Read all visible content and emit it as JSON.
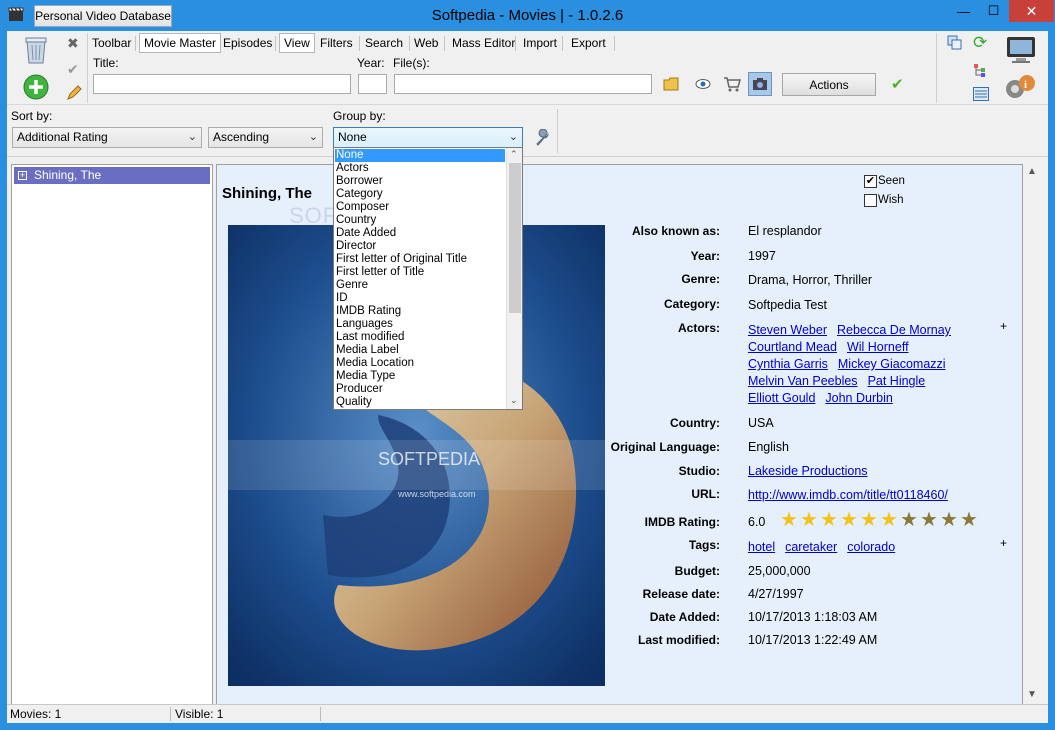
{
  "window": {
    "title": "Softpedia - Movies | - 1.0.2.6",
    "app_button": "Personal Video Database",
    "min": "—",
    "max": "☐",
    "close": "✕"
  },
  "toolbar": {
    "tabs": [
      "Toolbar",
      "Movie Master",
      "Episodes",
      "View",
      "Filters",
      "Search",
      "Web",
      "Mass Editor",
      "Import",
      "Export"
    ],
    "active_tab": "Movie Master",
    "title_label": "Title:",
    "year_label": "Year:",
    "files_label": "File(s):",
    "title_value": "",
    "year_value": "",
    "files_value": "",
    "actions_label": "Actions"
  },
  "sortbar": {
    "sort_by_label": "Sort by:",
    "sort_by_value": "Additional Rating",
    "order_value": "Ascending",
    "group_by_label": "Group by:",
    "group_by_value": "None"
  },
  "group_options": [
    "None",
    "Actors",
    "Borrower",
    "Category",
    "Composer",
    "Country",
    "Date Added",
    "Director",
    "First letter of Original Title",
    "First letter of Title",
    "Genre",
    "ID",
    "IMDB Rating",
    "Languages",
    "Last modified",
    "Media Label",
    "Media Location",
    "Media Type",
    "Producer",
    "Quality"
  ],
  "tree": {
    "expander": "+",
    "item": "Shining, The"
  },
  "movie": {
    "title": "Shining, The",
    "seen_label": "Seen",
    "seen_checked": true,
    "wish_label": "Wish",
    "wish_checked": false,
    "fields": {
      "aka_label": "Also known as:",
      "aka": "El resplandor",
      "year_label": "Year:",
      "year": "1997",
      "genre_label": "Genre:",
      "genre": "Drama, Horror, Thriller",
      "category_label": "Category:",
      "category": "Softpedia Test",
      "actors_label": "Actors:",
      "actors": [
        "Steven Weber",
        "Rebecca De Mornay",
        "Courtland Mead",
        "Wil Horneff",
        "Cynthia Garris",
        "Mickey Giacomazzi",
        "Melvin Van Peebles",
        "Pat Hingle",
        "Elliott Gould",
        "John Durbin"
      ],
      "country_label": "Country:",
      "country": "USA",
      "language_label": "Original Language:",
      "language": "English",
      "studio_label": "Studio:",
      "studio": "Lakeside Productions",
      "url_label": "URL:",
      "url": "http://www.imdb.com/title/tt0118460/",
      "rating_label": "IMDB Rating:",
      "rating": "6.0",
      "rating_stars": 6,
      "rating_max": 10,
      "tags_label": "Tags:",
      "tags": [
        "hotel",
        "caretaker",
        "colorado"
      ],
      "budget_label": "Budget:",
      "budget": "25,000,000",
      "release_label": "Release date:",
      "release": "4/27/1997",
      "added_label": "Date Added:",
      "added": "10/17/2013 1:18:03 AM",
      "modified_label": "Last modified:",
      "modified": "10/17/2013 1:22:49 AM"
    },
    "plus": "+",
    "poster_text": "SOFTPEDIA",
    "poster_url_text": "www.softpedia.com",
    "watermark": "SOFTPEDIA"
  },
  "status": {
    "movies": "Movies: 1",
    "visible": "Visible: 1"
  },
  "colors": {
    "title_bar": "#2b8fe0",
    "selection": "#6a6ec2",
    "detail_bg": "#e6f0fc",
    "link": "#0000cc",
    "star_on": "#f2c21a",
    "star_off": "#8a7a3a"
  }
}
